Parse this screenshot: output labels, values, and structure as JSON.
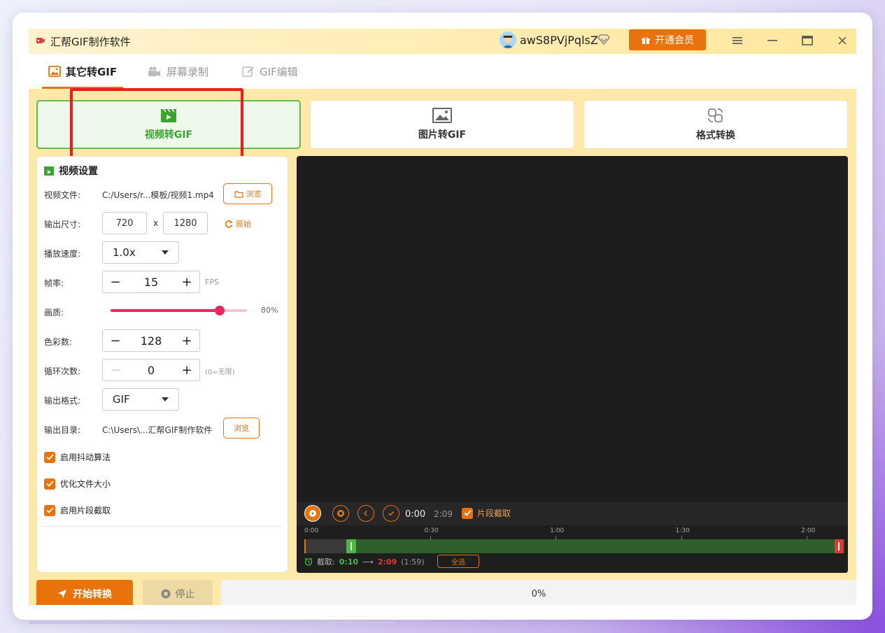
{
  "window": {
    "title": "汇帮GIF制作软件",
    "username": "awS8PVjPqlsZ",
    "vip_label": "开通会员"
  },
  "tabs": [
    {
      "label": "其它转GIF",
      "active": true
    },
    {
      "label": "屏幕录制",
      "active": false
    },
    {
      "label": "GIF编辑",
      "active": false
    }
  ],
  "modes": [
    {
      "label": "视频转GIF",
      "active": true
    },
    {
      "label": "图片转GIF",
      "active": false
    },
    {
      "label": "格式转换",
      "active": false
    }
  ],
  "settings": {
    "title": "视频设置",
    "video_file_label": "视频文件:",
    "video_file_value": "C:/Users/r...模板/视频1.mp4",
    "browse_label": "浏览",
    "size_label": "输出尺寸:",
    "width": "720",
    "height": "1280",
    "size_sep": "x",
    "reset_label": "原始",
    "speed_label": "播放速度:",
    "speed_value": "1.0x",
    "fps_label": "帧率:",
    "fps_value": "15",
    "fps_unit": "FPS",
    "quality_label": "画质:",
    "quality_value": "80%",
    "quality_fraction": 0.8,
    "colors_label": "色彩数:",
    "colors_value": "128",
    "loop_label": "循环次数:",
    "loop_value": "0",
    "loop_hint": "(0=无限)",
    "format_label": "输出格式:",
    "format_value": "GIF",
    "outdir_label": "输出目录:",
    "outdir_value": "C:\\Users\\...汇帮GIF制作软件",
    "outdir_browse": "浏览",
    "dither_label": "启用抖动算法",
    "optimize_label": "优化文件大小",
    "segment_label": "启用片段截取"
  },
  "player": {
    "current_time": "0:00",
    "total_time": "2:09",
    "segment_check": "片段截取",
    "ticks": [
      "0:00",
      "0:30",
      "1:00",
      "1:30",
      "2:00"
    ],
    "tick_seconds": [
      0,
      30,
      60,
      90,
      120
    ],
    "duration_seconds": 129,
    "clip_start_seconds": 10,
    "clip_end_seconds": 129,
    "clip_label": "截取:",
    "clip_start": "0:10",
    "clip_arrow": "⟶",
    "clip_end": "2:09",
    "clip_len": "(1:59)",
    "select_all": "全选"
  },
  "bottom": {
    "start_label": "开始转换",
    "stop_label": "停止",
    "progress_text": "0%",
    "progress_fraction": 0
  },
  "colors": {
    "accent": "#e8720c",
    "active_green": "#3aa52c",
    "highlight_red": "#f21b1b",
    "slider_pink": "#e8285f"
  }
}
